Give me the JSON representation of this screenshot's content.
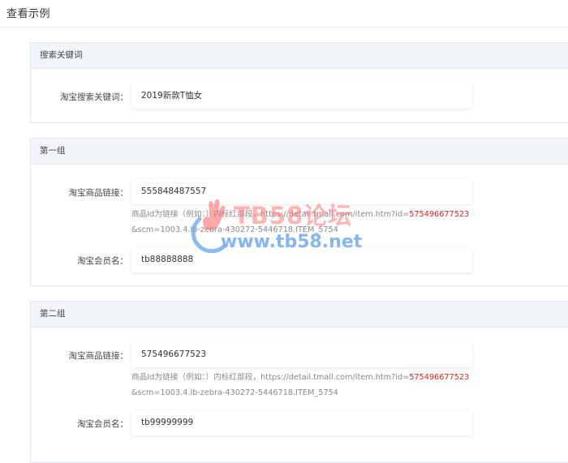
{
  "page": {
    "title": "查看示例"
  },
  "sections": [
    {
      "header": "搜索关键词",
      "fields": [
        {
          "label": "淘宝搜索关键词：",
          "value": "2019新款T恤女"
        }
      ]
    },
    {
      "header": "第一组",
      "fields": [
        {
          "label": "淘宝商品链接：",
          "value": "555848487557"
        },
        {
          "label": "淘宝会员名：",
          "value": "tb88888888"
        }
      ],
      "hint": {
        "prefix": "商品Id为链接（例如：）内标红部段，https://detail.tmall.com/item.htm?id=",
        "highlight": "575496677523",
        "line2": "&scm=1003.4.lb-zebra-430272-5446718.ITEM_5754"
      }
    },
    {
      "header": "第二组",
      "fields": [
        {
          "label": "淘宝商品链接：",
          "value": "575496677523"
        },
        {
          "label": "淘宝会员名：",
          "value": "tb99999999"
        }
      ],
      "hint": {
        "prefix": "商品Id为链接（例如：）内标红部段，https://detail.tmall.com/item.htm?id=",
        "highlight": "575496677523",
        "line2": "&scm=1003.4.lb-zebra-430272-5446718.ITEM_5754"
      }
    }
  ],
  "watermark": {
    "line1": "TB58论坛",
    "line2": "www.tb58.net"
  },
  "colors": {
    "header_bg": "#f2f6fb",
    "highlight_red": "#e42222",
    "watermark_red": "#ff7878",
    "watermark_blue": "#6eaaf0"
  }
}
